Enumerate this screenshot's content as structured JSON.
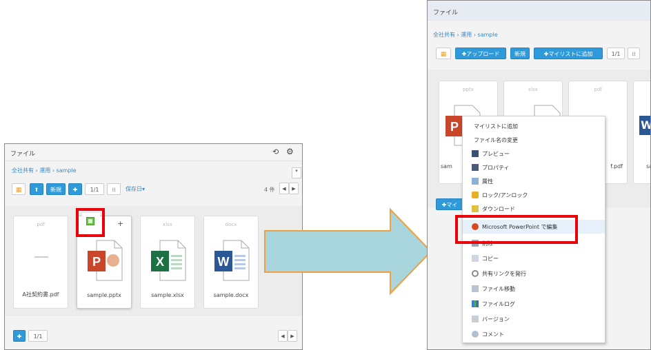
{
  "left": {
    "title": "ファイル",
    "header_icons": {
      "sync": "⟲",
      "gear": "⚙"
    },
    "breadcrumb": "全社共有 › 運用 › sample",
    "toolbar": {
      "new_label": "新規",
      "page": "1/1",
      "sort_label": "保存日▾",
      "count": "4 件"
    },
    "footer_page": "1/1",
    "files": [
      {
        "ext": "pdf",
        "name": "A社契約書.pdf"
      },
      {
        "ext": "",
        "name": "sample.pptx"
      },
      {
        "ext": "xlsx",
        "name": "sample.xlsx"
      },
      {
        "ext": "docx",
        "name": "sample.docx"
      }
    ]
  },
  "right": {
    "title": "ファイル",
    "breadcrumb": "全社共有 › 運用 › sample",
    "toolbar": {
      "upload_label": "✚アップロード",
      "new_label": "新規",
      "mylist_label": "✚マイリストに追加",
      "page": "1/1"
    },
    "files": [
      {
        "ext": "pptx",
        "name": "sam"
      },
      {
        "ext": "xlsx",
        "name": ""
      },
      {
        "ext": "pdf",
        "name": "f.pdf"
      },
      {
        "ext": "",
        "name": "sa"
      }
    ],
    "bottom_button": "✚マイ"
  },
  "context_menu": {
    "items": [
      {
        "label": "マイリストに追加",
        "icon": "none"
      },
      {
        "label": "ファイル名の変更",
        "icon": "none"
      },
      {
        "label": "プレビュー",
        "icon": "preview-icon"
      },
      {
        "label": "プロパティ",
        "icon": "properties-icon"
      },
      {
        "label": "属性",
        "icon": "attribute-icon"
      },
      {
        "label": "ロック/アンロック",
        "icon": "lock-icon"
      },
      {
        "label": "ダウンロード",
        "icon": "download-icon"
      },
      {
        "label": "Microsoft PowerPoint で編集",
        "icon": "office-icon"
      },
      {
        "label": "削除",
        "icon": "delete-icon"
      },
      {
        "label": "コピー",
        "icon": "copy-icon"
      },
      {
        "label": "共有リンクを発行",
        "icon": "link-icon"
      },
      {
        "label": "ファイル移動",
        "icon": "move-icon"
      },
      {
        "label": "ファイルログ",
        "icon": "log-icon"
      },
      {
        "label": "バージョン",
        "icon": "version-icon"
      },
      {
        "label": "コメント",
        "icon": "comment-icon"
      }
    ],
    "highlighted_index": 7
  },
  "colors": {
    "accent": "#2e9ad9",
    "highlight_box": "#e8000b",
    "arrow_fill": "#a9d6dd",
    "arrow_border": "#f0a040",
    "ppt": "#c8472a",
    "excel": "#1e7145",
    "word": "#2b5797"
  }
}
